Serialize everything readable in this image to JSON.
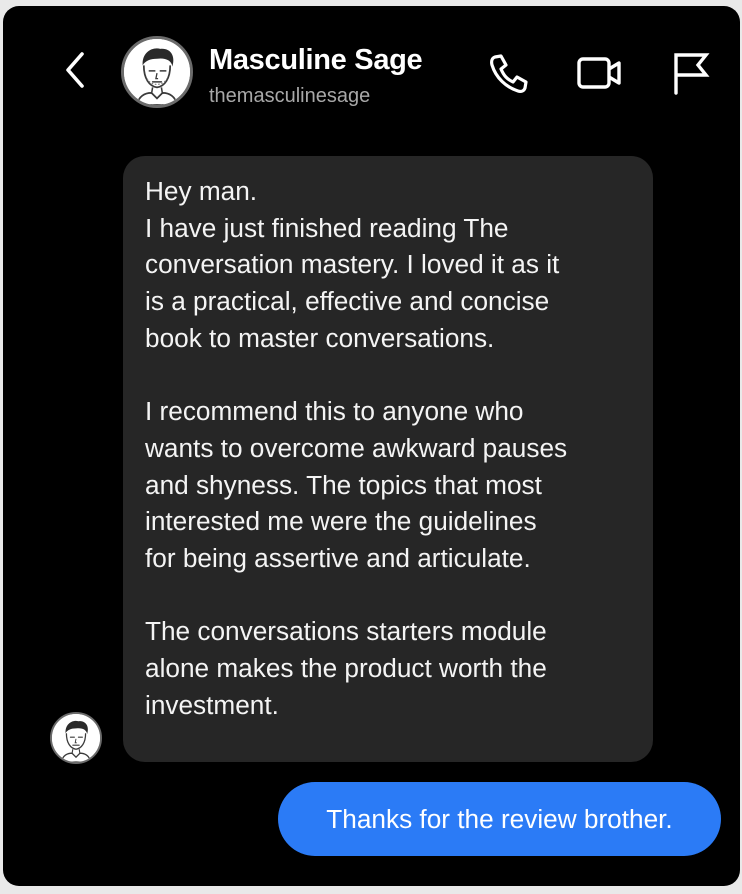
{
  "header": {
    "name": "Masculine Sage",
    "handle": "themasculinesage"
  },
  "icons": {
    "back": "chevron-left-icon",
    "call": "phone-icon",
    "video": "video-camera-icon",
    "flag": "flag-icon",
    "avatar": "avatar-sketch-icon"
  },
  "colors": {
    "background": "#000000",
    "incoming_bubble": "#262626",
    "outgoing_bubble": "#2b7bf6",
    "text_primary": "#f4f4f4",
    "text_secondary": "#a8a8a8"
  },
  "messages": [
    {
      "direction": "incoming",
      "paragraphs": [
        "Hey man.\nI have just finished reading The\nconversation mastery. I loved it as it\nis a practical, effective and concise\nbook to master conversations.",
        "I recommend this to anyone who\nwants to overcome awkward pauses\nand shyness. The topics that most\ninterested me were the guidelines\nfor being assertive and articulate.",
        "The conversations starters module\nalone makes the product worth the\ninvestment."
      ]
    },
    {
      "direction": "outgoing",
      "text": "Thanks for the review brother."
    }
  ]
}
